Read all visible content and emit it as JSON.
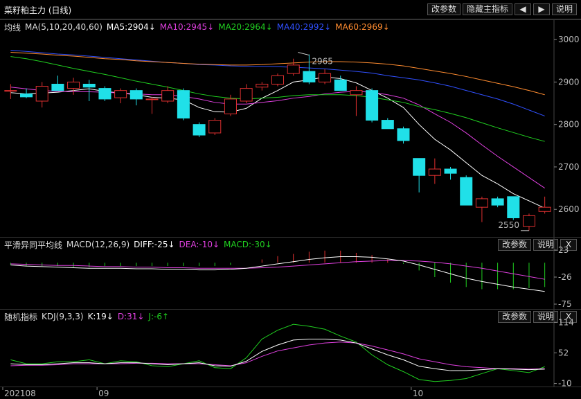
{
  "window": {
    "title": "菜籽粕主力 (日线)",
    "buttons": [
      "改参数",
      "隐藏主指标",
      "说明"
    ],
    "nav_left_icon": "arrow-left-icon",
    "nav_right_icon": "arrow-right-icon"
  },
  "main_panel": {
    "indicator_name": "均线",
    "params": "MA(5,10,20,40,60)",
    "legend": [
      {
        "label": "MA5:2904↓",
        "color": "#ffffff"
      },
      {
        "label": "MA10:2945↓",
        "color": "#e040e0"
      },
      {
        "label": "MA20:2964↓",
        "color": "#20d020"
      },
      {
        "label": "MA40:2992↓",
        "color": "#3050ff"
      },
      {
        "label": "MA60:2969↓",
        "color": "#ff8c30"
      }
    ],
    "high_label": "2965",
    "low_label": "2550"
  },
  "macd_panel": {
    "name": "平滑异同平均线",
    "params": "MACD(12,26,9)",
    "legend": [
      {
        "label": "DIFF:-25↓",
        "color": "#ffffff"
      },
      {
        "label": "DEA:-10↓",
        "color": "#e040e0"
      },
      {
        "label": "MACD:-30↓",
        "color": "#20d020"
      }
    ],
    "buttons": [
      "改参数",
      "说明",
      "X"
    ],
    "y_ticks": [
      "23",
      "-26",
      "-75"
    ]
  },
  "kdj_panel": {
    "name": "随机指标",
    "params": "KDJ(9,3,3)",
    "legend": [
      {
        "label": "K:19↓",
        "color": "#ffffff"
      },
      {
        "label": "D:31↓",
        "color": "#e040e0"
      },
      {
        "label": "J:-6↑",
        "color": "#20d020"
      }
    ],
    "buttons": [
      "改参数",
      "说明",
      "X"
    ],
    "y_ticks": [
      "114",
      "52",
      "-10"
    ]
  },
  "x_axis": {
    "labels": [
      "202108",
      "09",
      "10"
    ]
  },
  "chart_data": {
    "type": "candlestick",
    "ylim": [
      2540,
      3010
    ],
    "y_ticks": [
      3000,
      2900,
      2800,
      2700,
      2600
    ],
    "candles": [
      {
        "o": 2880,
        "h": 2895,
        "l": 2860,
        "c": 2880
      },
      {
        "o": 2872,
        "h": 2885,
        "l": 2862,
        "c": 2865
      },
      {
        "o": 2855,
        "h": 2900,
        "l": 2840,
        "c": 2890
      },
      {
        "o": 2895,
        "h": 2915,
        "l": 2880,
        "c": 2880
      },
      {
        "o": 2885,
        "h": 2910,
        "l": 2870,
        "c": 2900
      },
      {
        "o": 2895,
        "h": 2905,
        "l": 2855,
        "c": 2888
      },
      {
        "o": 2885,
        "h": 2890,
        "l": 2855,
        "c": 2860
      },
      {
        "o": 2863,
        "h": 2885,
        "l": 2850,
        "c": 2880
      },
      {
        "o": 2880,
        "h": 2885,
        "l": 2845,
        "c": 2860
      },
      {
        "o": 2860,
        "h": 2865,
        "l": 2825,
        "c": 2860
      },
      {
        "o": 2855,
        "h": 2890,
        "l": 2850,
        "c": 2880
      },
      {
        "o": 2880,
        "h": 2885,
        "l": 2810,
        "c": 2815
      },
      {
        "o": 2800,
        "h": 2805,
        "l": 2770,
        "c": 2775
      },
      {
        "o": 2780,
        "h": 2815,
        "l": 2775,
        "c": 2810
      },
      {
        "o": 2825,
        "h": 2870,
        "l": 2820,
        "c": 2860
      },
      {
        "o": 2855,
        "h": 2895,
        "l": 2850,
        "c": 2885
      },
      {
        "o": 2888,
        "h": 2900,
        "l": 2880,
        "c": 2895
      },
      {
        "o": 2895,
        "h": 2920,
        "l": 2890,
        "c": 2915
      },
      {
        "o": 2920,
        "h": 2955,
        "l": 2915,
        "c": 2940
      },
      {
        "o": 2925,
        "h": 2965,
        "l": 2895,
        "c": 2900
      },
      {
        "o": 2900,
        "h": 2930,
        "l": 2895,
        "c": 2920
      },
      {
        "o": 2905,
        "h": 2915,
        "l": 2880,
        "c": 2880
      },
      {
        "o": 2870,
        "h": 2890,
        "l": 2820,
        "c": 2880
      },
      {
        "o": 2880,
        "h": 2885,
        "l": 2805,
        "c": 2810
      },
      {
        "o": 2810,
        "h": 2815,
        "l": 2790,
        "c": 2790
      },
      {
        "o": 2790,
        "h": 2795,
        "l": 2755,
        "c": 2762
      },
      {
        "o": 2720,
        "h": 2720,
        "l": 2640,
        "c": 2680
      },
      {
        "o": 2680,
        "h": 2720,
        "l": 2660,
        "c": 2695
      },
      {
        "o": 2695,
        "h": 2700,
        "l": 2670,
        "c": 2685
      },
      {
        "o": 2675,
        "h": 2680,
        "l": 2610,
        "c": 2610
      },
      {
        "o": 2605,
        "h": 2630,
        "l": 2570,
        "c": 2625
      },
      {
        "o": 2625,
        "h": 2630,
        "l": 2605,
        "c": 2610
      },
      {
        "o": 2630,
        "h": 2630,
        "l": 2575,
        "c": 2580
      },
      {
        "o": 2560,
        "h": 2590,
        "l": 2550,
        "c": 2585
      },
      {
        "o": 2595,
        "h": 2630,
        "l": 2590,
        "c": 2605
      }
    ],
    "ma": [
      {
        "name": "MA5",
        "values": [
          2875,
          2872,
          2874,
          2876,
          2880,
          2884,
          2878,
          2874,
          2870,
          2864,
          2862,
          2858,
          2840,
          2830,
          2829,
          2838,
          2862,
          2880,
          2900,
          2905,
          2912,
          2908,
          2898,
          2880,
          2862,
          2840,
          2800,
          2765,
          2740,
          2710,
          2680,
          2660,
          2637,
          2620,
          2603
        ]
      },
      {
        "name": "MA10",
        "values": [
          2888,
          2884,
          2880,
          2878,
          2877,
          2877,
          2876,
          2874,
          2872,
          2870,
          2870,
          2866,
          2860,
          2852,
          2848,
          2848,
          2852,
          2856,
          2862,
          2866,
          2872,
          2876,
          2878,
          2876,
          2870,
          2862,
          2846,
          2825,
          2805,
          2780,
          2752,
          2725,
          2700,
          2675,
          2650
        ]
      },
      {
        "name": "MA20",
        "values": [
          2960,
          2955,
          2948,
          2940,
          2932,
          2925,
          2918,
          2910,
          2902,
          2895,
          2888,
          2880,
          2872,
          2866,
          2862,
          2860,
          2862,
          2864,
          2868,
          2870,
          2870,
          2870,
          2868,
          2864,
          2858,
          2852,
          2842,
          2835,
          2826,
          2816,
          2804,
          2792,
          2781,
          2770,
          2760
        ]
      },
      {
        "name": "MA40",
        "values": [
          2975,
          2972,
          2969,
          2966,
          2964,
          2961,
          2958,
          2955,
          2952,
          2949,
          2946,
          2944,
          2941,
          2940,
          2938,
          2937,
          2937,
          2936,
          2935,
          2933,
          2931,
          2928,
          2925,
          2921,
          2915,
          2910,
          2905,
          2898,
          2890,
          2880,
          2870,
          2860,
          2848,
          2834,
          2820
        ]
      },
      {
        "name": "MA60",
        "values": [
          2970,
          2968,
          2966,
          2963,
          2961,
          2958,
          2955,
          2953,
          2950,
          2948,
          2946,
          2944,
          2942,
          2941,
          2940,
          2940,
          2941,
          2943,
          2945,
          2947,
          2948,
          2948,
          2947,
          2945,
          2942,
          2938,
          2932,
          2926,
          2920,
          2913,
          2905,
          2897,
          2889,
          2880,
          2870
        ]
      }
    ],
    "macd": {
      "ylim": [
        -80,
        28
      ],
      "diff": [
        -4,
        -6,
        -7,
        -8,
        -9,
        -10,
        -10,
        -10,
        -11,
        -11,
        -12,
        -12,
        -13,
        -13,
        -12,
        -10,
        -6,
        -2,
        2,
        6,
        9,
        11,
        11,
        10,
        7,
        3,
        -4,
        -12,
        -20,
        -28,
        -34,
        -39,
        -44,
        -48,
        -52
      ],
      "dea": [
        -2,
        -3,
        -4,
        -5,
        -5,
        -6,
        -7,
        -7,
        -8,
        -8,
        -9,
        -9,
        -10,
        -10,
        -10,
        -10,
        -9,
        -8,
        -6,
        -4,
        -2,
        0,
        2,
        3,
        4,
        4,
        3,
        1,
        -2,
        -6,
        -10,
        -15,
        -20,
        -25,
        -30
      ],
      "bar": [
        -4,
        -6,
        -6,
        -6,
        -8,
        -8,
        -6,
        -6,
        -6,
        -6,
        -6,
        -6,
        -6,
        -6,
        -4,
        0,
        6,
        12,
        16,
        20,
        22,
        22,
        18,
        14,
        6,
        -2,
        -14,
        -26,
        -36,
        -44,
        -48,
        -48,
        -48,
        -46,
        -44
      ]
    },
    "kdj": {
      "ylim": [
        -12,
        120
      ],
      "k": [
        30,
        28,
        28,
        30,
        32,
        32,
        30,
        32,
        32,
        30,
        28,
        30,
        32,
        26,
        25,
        35,
        55,
        68,
        78,
        80,
        80,
        78,
        72,
        60,
        48,
        38,
        25,
        20,
        16,
        16,
        18,
        20,
        19,
        18,
        19
      ],
      "d": [
        26,
        27,
        27,
        28,
        30,
        30,
        30,
        30,
        31,
        31,
        30,
        30,
        30,
        28,
        26,
        32,
        45,
        56,
        62,
        68,
        72,
        74,
        72,
        66,
        58,
        50,
        40,
        34,
        28,
        24,
        22,
        20,
        20,
        19,
        20
      ],
      "j": [
        38,
        30,
        30,
        34,
        34,
        38,
        30,
        36,
        34,
        26,
        24,
        30,
        36,
        22,
        20,
        42,
        80,
        98,
        110,
        106,
        100,
        86,
        74,
        48,
        28,
        14,
        -2,
        -6,
        -4,
        0,
        10,
        20,
        16,
        12,
        24
      ]
    }
  }
}
